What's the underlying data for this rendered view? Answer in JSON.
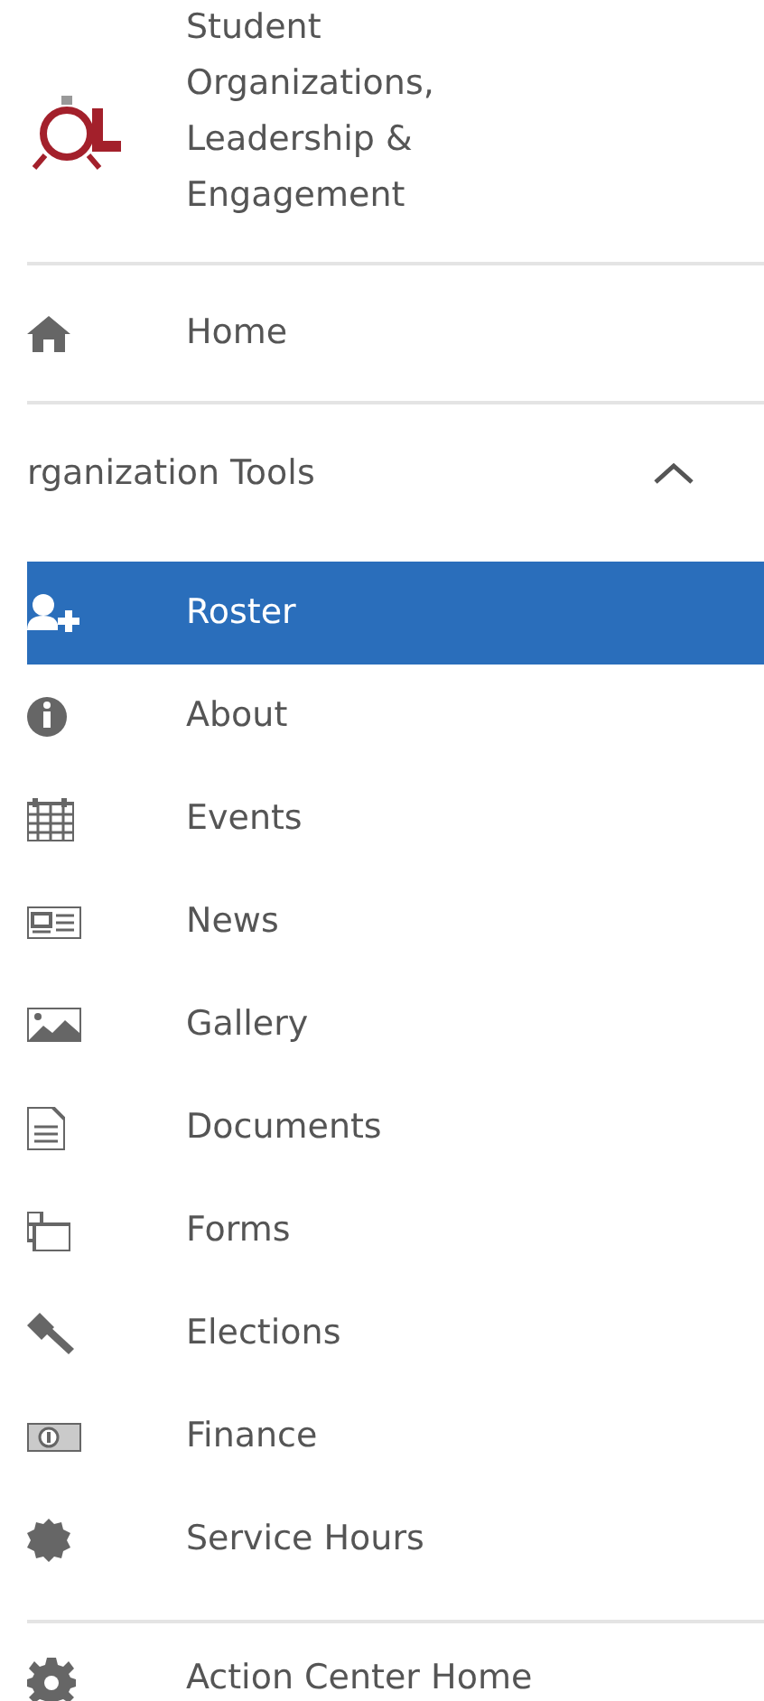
{
  "header": {
    "title": "Student Organizations, Leadership & Engagement"
  },
  "home": {
    "label": "Home"
  },
  "section": {
    "label": "rganization Tools",
    "expanded": true,
    "items": [
      {
        "label": "Roster",
        "selected": true
      },
      {
        "label": "About",
        "selected": false
      },
      {
        "label": "Events",
        "selected": false
      },
      {
        "label": "News",
        "selected": false
      },
      {
        "label": "Gallery",
        "selected": false
      },
      {
        "label": "Documents",
        "selected": false
      },
      {
        "label": "Forms",
        "selected": false
      },
      {
        "label": "Elections",
        "selected": false
      },
      {
        "label": "Finance",
        "selected": false
      },
      {
        "label": "Service Hours",
        "selected": false
      }
    ]
  },
  "footer": {
    "label": "Action Center Home"
  }
}
